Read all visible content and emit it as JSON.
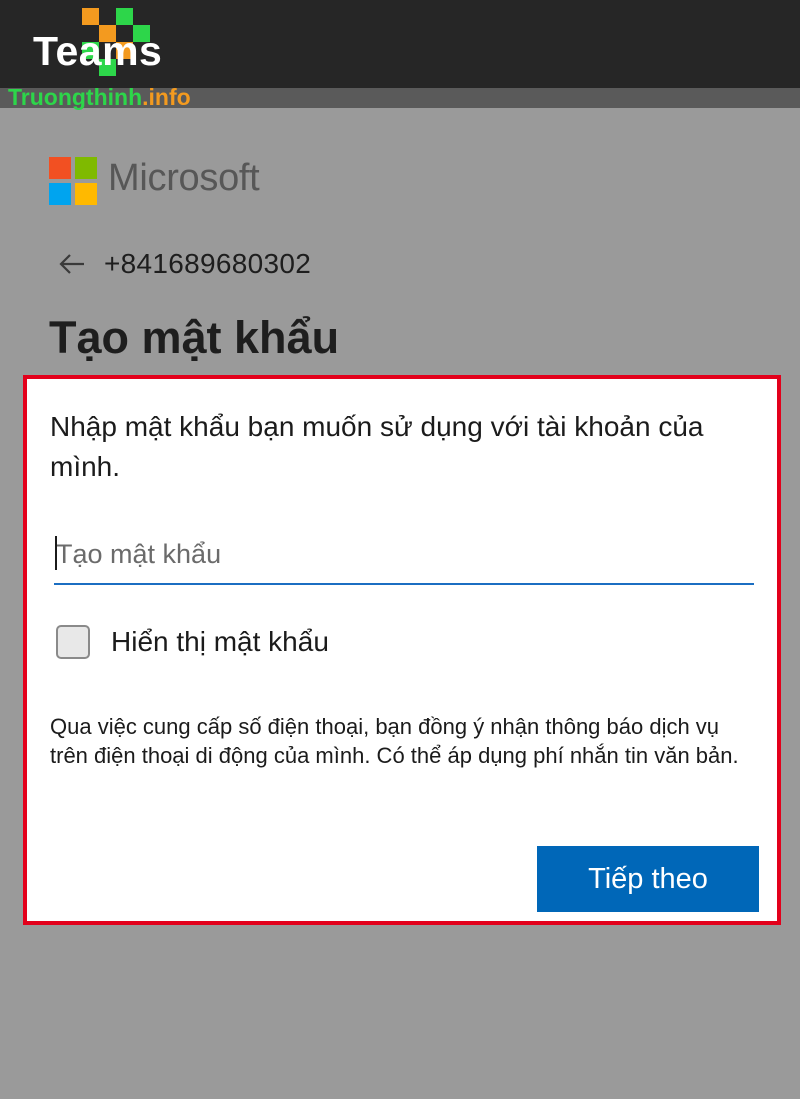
{
  "watermark": {
    "app_name": "Teams",
    "site_main": "Truongthinh",
    "site_suffix": ".info",
    "colors": {
      "green": "#2dd64a",
      "orange": "#f39a1f"
    }
  },
  "brand": {
    "name": "Microsoft",
    "logo_colors": [
      "#f25022",
      "#7fba00",
      "#00a4ef",
      "#ffb900"
    ]
  },
  "account": {
    "back_icon": "arrow-left-icon",
    "identifier": "+841689680302"
  },
  "page": {
    "title": "Tạo mật khẩu",
    "description": "Nhập mật khẩu bạn muốn sử dụng với tài khoản của mình."
  },
  "password_field": {
    "placeholder": "Tạo mật khẩu",
    "value": ""
  },
  "show_password": {
    "label": "Hiển thị mật khẩu",
    "checked": false
  },
  "notice": "Qua việc cung cấp số điện thoại, bạn đồng ý nhận thông báo dịch vụ trên điện thoại di động của mình. Có thể áp dụng phí nhắn tin văn bản.",
  "next_button": {
    "label": "Tiếp theo",
    "color": "#0067b8"
  },
  "highlight_color": "#e3001b"
}
